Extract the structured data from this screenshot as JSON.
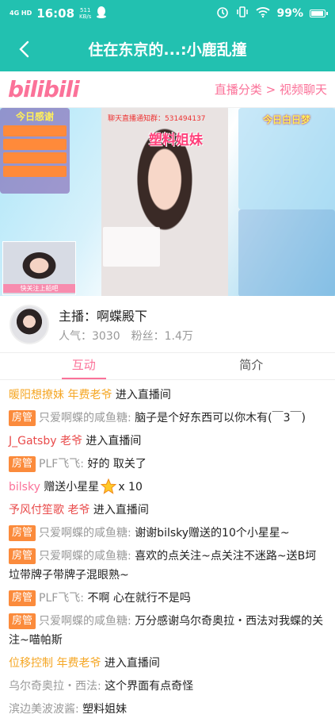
{
  "status_bar": {
    "signal": "4G HD",
    "time": "16:08",
    "speed_value": "511",
    "speed_unit": "KB/s",
    "battery": "99%",
    "battery_level": 0.99
  },
  "title_bar": {
    "title": "住在东京的...:小鹿乱撞"
  },
  "bili_header": {
    "logo": "bilibili",
    "category": "直播分类 > 视频聊天"
  },
  "video": {
    "left_panel_title": "今日感谢",
    "right_panel_title": "今日白日梦",
    "notice": "聊天直播通知群：531494137",
    "sticker": "塑料姐妹",
    "thumb_caption": "快关注上船吧"
  },
  "anchor": {
    "name": "主播：啊蝶殿下",
    "popularity": "人气：3030",
    "fans": "粉丝：1.4万"
  },
  "tabs": [
    {
      "label": "互动",
      "active": true
    },
    {
      "label": "简介",
      "active": false
    }
  ],
  "chat": [
    {
      "user": "暖阳想撩妹 年费老爷",
      "user_color": "orange",
      "text": "进入直播间"
    },
    {
      "badge": "房管",
      "user": "只爱啊蝶的咸鱼糖:",
      "user_color": "gray",
      "text": "脑子是个好东西可以你木有(￣3￣)"
    },
    {
      "user": "J_Gatsby 老爷",
      "user_color": "red",
      "text": "进入直播间"
    },
    {
      "badge": "房管",
      "user": "PLF飞飞:",
      "user_color": "gray",
      "text": "好的 取关了"
    },
    {
      "user": "bilsky",
      "user_color": "pink",
      "text": "赠送小星星",
      "gift_icon": "star-gift-icon",
      "gift_count": "x 10"
    },
    {
      "user": "予风付笙歌 老爷",
      "user_color": "red",
      "text": "进入直播间"
    },
    {
      "badge": "房管",
      "user": "只爱啊蝶的咸鱼糖:",
      "user_color": "gray",
      "text": "谢谢bilsky赠送的10个小星星~"
    },
    {
      "badge": "房管",
      "user": "只爱啊蝶的咸鱼糖:",
      "user_color": "gray",
      "text": "喜欢的点关注~点关注不迷路~送B坷垃带牌子带牌子混眼熟~"
    },
    {
      "badge": "房管",
      "user": "PLF飞飞:",
      "user_color": "gray",
      "text": "不啊 心在就行不是吗"
    },
    {
      "badge": "房管",
      "user": "只爱啊蝶的咸鱼糖:",
      "user_color": "gray",
      "text": "万分感谢乌尔奇奥拉・西法对我蝶的关注~喵帕斯"
    },
    {
      "user": "位移控制 年费老爷",
      "user_color": "orange",
      "text": "进入直播间"
    },
    {
      "user": "乌尔奇奥拉・西法:",
      "user_color": "gray",
      "text": "这个界面有点奇怪"
    },
    {
      "user": "滨边美波波酱:",
      "user_color": "gray",
      "text": "塑料姐妹"
    }
  ],
  "colors": {
    "teal": "#22c1b0",
    "pink": "#fb7299",
    "badge": "#fb8b3c"
  }
}
